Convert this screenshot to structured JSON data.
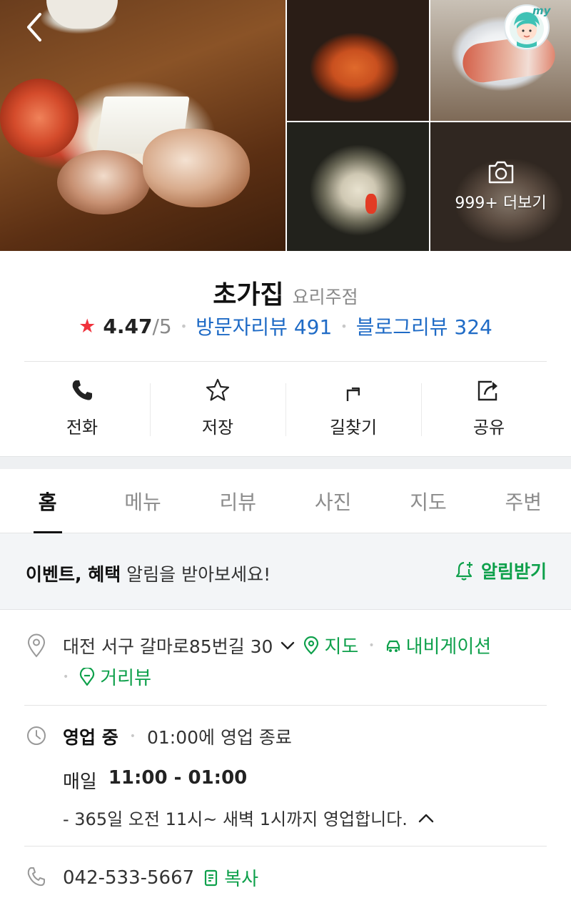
{
  "gallery": {
    "more_label": "999+ 더보기"
  },
  "place": {
    "name": "초가집",
    "category": "요리주점",
    "rating": "4.47",
    "rating_max": "/5",
    "visitor_reviews": "방문자리뷰 491",
    "blog_reviews": "블로그리뷰 324"
  },
  "actions": [
    {
      "label": "전화",
      "icon": "phone-icon"
    },
    {
      "label": "저장",
      "icon": "star-outline-icon"
    },
    {
      "label": "길찾기",
      "icon": "directions-icon"
    },
    {
      "label": "공유",
      "icon": "share-icon"
    }
  ],
  "tabs": [
    "홈",
    "메뉴",
    "리뷰",
    "사진",
    "지도",
    "주변"
  ],
  "active_tab": "홈",
  "notice": {
    "bold": "이벤트, 혜택",
    "text": " 알림을 받아보세요!",
    "button": "알림받기"
  },
  "address": {
    "text": "대전 서구 갈마로85번길 30",
    "map_link": "지도",
    "navi_link": "내비게이션",
    "street_view": "거리뷰"
  },
  "hours": {
    "status": "영업 중",
    "closing": "01:00에 영업 종료",
    "day": "매일",
    "time": "11:00 - 01:00",
    "note": "- 365일 오전 11시~ 새벽 1시까지 영업합니다."
  },
  "phone": {
    "number": "042-533-5667",
    "copy": "복사"
  },
  "colors": {
    "accent_green": "#0ea04b",
    "review_blue": "#1f6bc6",
    "star_red": "#f0323c"
  }
}
